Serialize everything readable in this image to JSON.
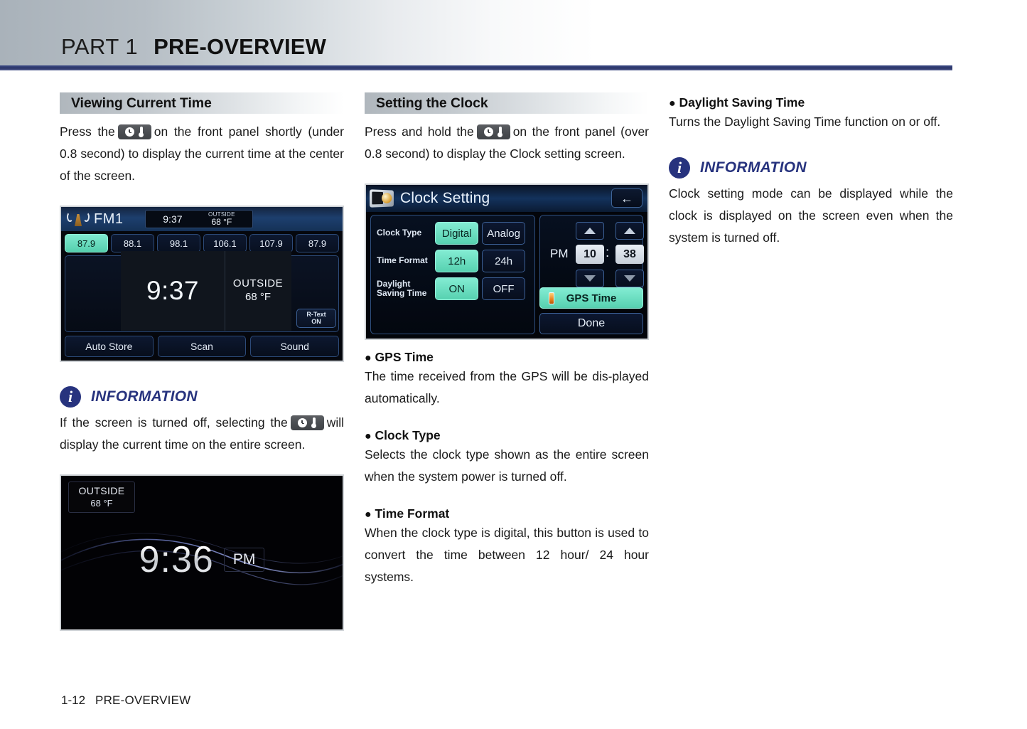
{
  "header": {
    "part_label": "PART 1",
    "part_title": "PRE-OVERVIEW"
  },
  "footer": {
    "page_number": "1-12",
    "page_title": "PRE-OVERVIEW"
  },
  "column1": {
    "section_heading": "Viewing Current Time",
    "paragraph_a": "Press the",
    "paragraph_b": "on the front panel shortly (under 0.8 second) to display the current time at the center of the screen.",
    "info_title": "INFORMATION",
    "info_text_a": "If the screen is turned off, selecting the",
    "info_text_b": "will display the current time on the entire screen.",
    "panel_button_icon": "clock-thermometer-button-icon"
  },
  "column2": {
    "section_heading": "Setting the Clock",
    "paragraph_a": "Press and hold the",
    "paragraph_b": "on the front panel (over 0.8 second) to display the Clock setting screen.",
    "bullets": [
      {
        "title": "GPS Time",
        "body": "The time received from the GPS will be dis-played automatically."
      },
      {
        "title": "Clock Type",
        "body": "Selects the clock type shown as the entire screen when the system power is turned off."
      },
      {
        "title": "Time Format",
        "body": "When the clock type is digital, this button is used to convert the time between 12 hour/ 24 hour systems."
      }
    ]
  },
  "column3": {
    "bullet_title": "Daylight Saving Time",
    "bullet_body": "Turns the Daylight Saving Time function on or off.",
    "info_title": "INFORMATION",
    "info_text": "Clock setting mode can be displayed while the clock is displayed on the screen even when the system is turned off."
  },
  "radio_screen": {
    "tower_icon": "radio-tower-icon",
    "band": "FM1",
    "status_time": "9:37",
    "status_outside_label": "OUTSIDE",
    "status_outside_value": "68  °F",
    "presets": [
      "87.9",
      "88.1",
      "98.1",
      "106.1",
      "107.9",
      "87.9"
    ],
    "active_preset_index": 0,
    "rtext_line1": "R-Text",
    "rtext_line2": "ON",
    "overlay_time": "9:37",
    "overlay_outside_label": "OUTSIDE",
    "overlay_outside_value": "68  °F",
    "bottom_buttons": [
      "Auto Store",
      "Scan",
      "Sound"
    ]
  },
  "clock_setting_screen": {
    "title_icon": "clock-calendar-icon",
    "title": "Clock Setting",
    "back_icon": "back-arrow-icon",
    "rows": [
      {
        "label": "Clock Type",
        "option_on": "Digital",
        "option_off": "Analog",
        "selected": "Digital"
      },
      {
        "label": "Time Format",
        "option_on": "12h",
        "option_off": "24h",
        "selected": "12h"
      },
      {
        "label": "Daylight Saving Time",
        "option_on": "ON",
        "option_off": "OFF",
        "selected": "ON"
      }
    ],
    "meridiem": "PM",
    "hour": "10",
    "colon": ":",
    "minute": "38",
    "gps_button": "GPS Time",
    "done_button": "Done"
  },
  "full_clock_screen": {
    "outside_label": "OUTSIDE",
    "outside_value": "68  °F",
    "time": "9:36",
    "meridiem": "PM"
  },
  "colors": {
    "accent_blue": "#27337e",
    "rule_blue": "#2b3568",
    "screen_teal": "#57d1b0",
    "screen_blue": "#13325c",
    "indicator_orange": "#e8801a"
  }
}
